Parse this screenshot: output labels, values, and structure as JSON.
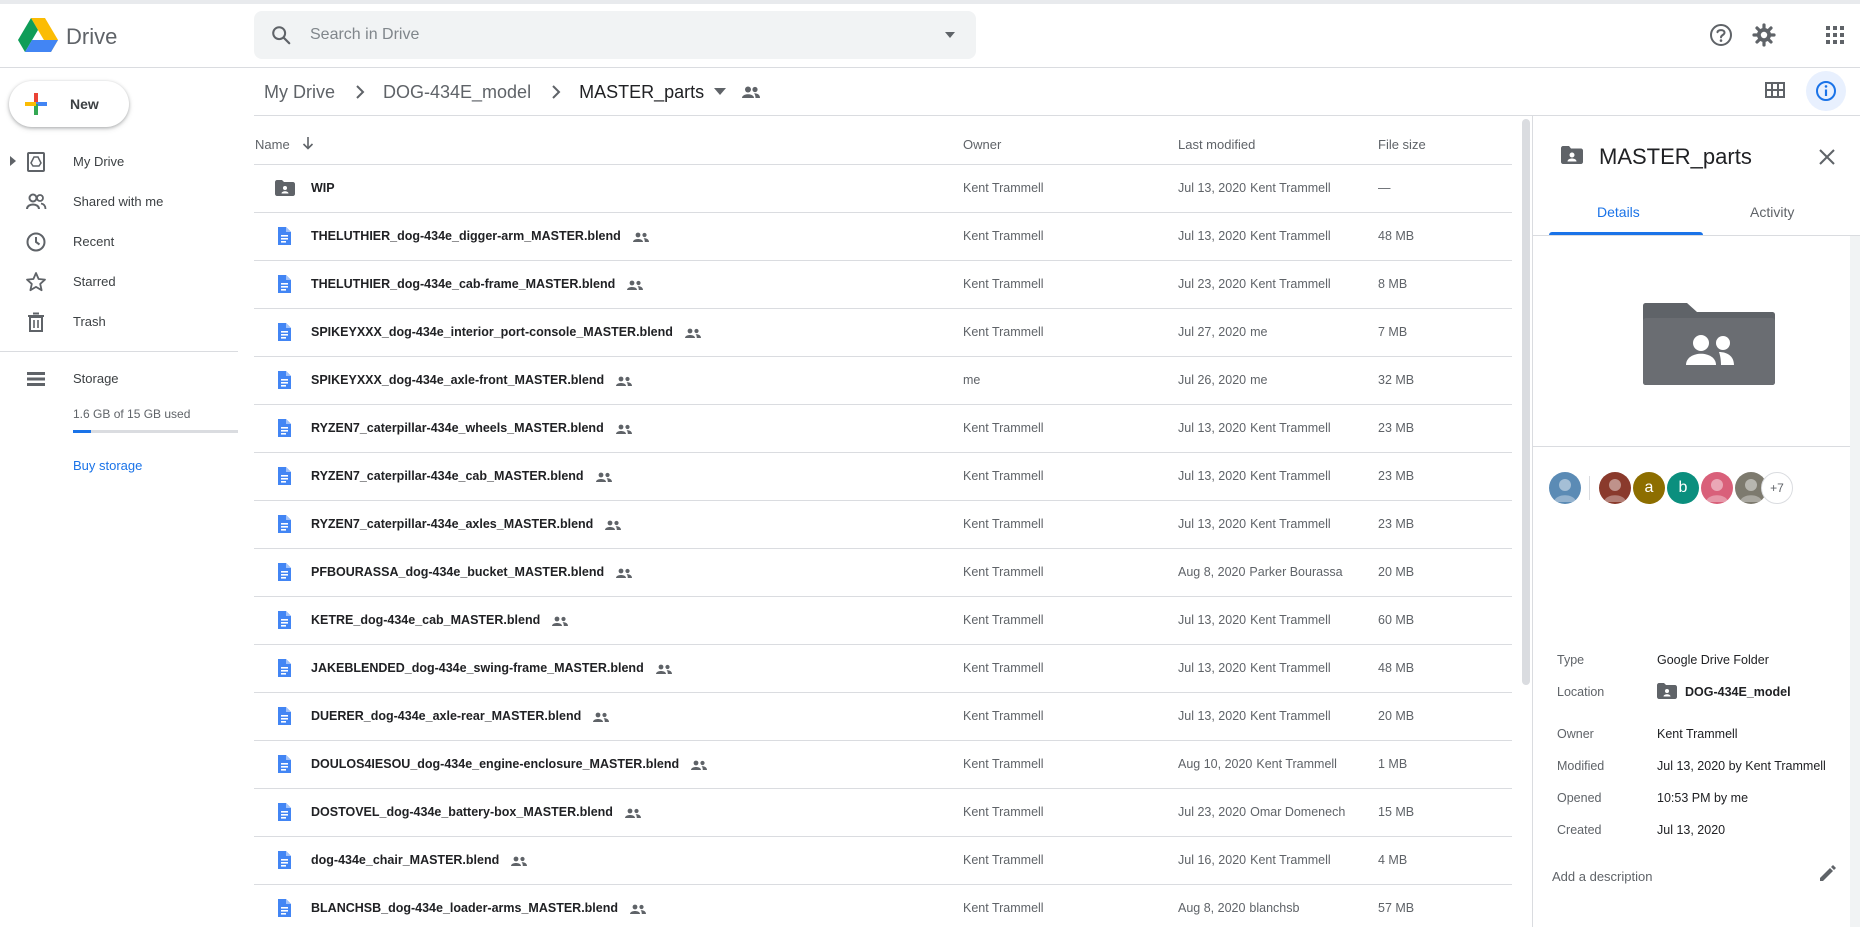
{
  "app": {
    "name": "Drive"
  },
  "search": {
    "placeholder": "Search in Drive"
  },
  "nav": {
    "new_label": "New",
    "items": [
      {
        "label": "My Drive",
        "icon": "my-drive-icon"
      },
      {
        "label": "Shared with me",
        "icon": "people-icon"
      },
      {
        "label": "Recent",
        "icon": "clock-icon"
      },
      {
        "label": "Starred",
        "icon": "star-icon"
      },
      {
        "label": "Trash",
        "icon": "trash-icon"
      }
    ],
    "storage_label": "Storage",
    "storage_used": "1.6 GB of 15 GB used",
    "storage_fraction": 0.107,
    "buy_storage": "Buy storage"
  },
  "breadcrumb": [
    "My Drive",
    "DOG-434E_model",
    "MASTER_parts"
  ],
  "table": {
    "headers": {
      "name": "Name",
      "owner": "Owner",
      "modified": "Last modified",
      "size": "File size"
    },
    "rows": [
      {
        "type": "shared-folder",
        "name": "WIP",
        "shared": false,
        "owner": "Kent Trammell",
        "date": "Jul 13, 2020",
        "by": "Kent Trammell",
        "size": "—"
      },
      {
        "type": "file",
        "name": "THELUTHIER_dog-434e_digger-arm_MASTER.blend",
        "shared": true,
        "owner": "Kent Trammell",
        "date": "Jul 13, 2020",
        "by": "Kent Trammell",
        "size": "48 MB"
      },
      {
        "type": "file",
        "name": "THELUTHIER_dog-434e_cab-frame_MASTER.blend",
        "shared": true,
        "owner": "Kent Trammell",
        "date": "Jul 23, 2020",
        "by": "Kent Trammell",
        "size": "8 MB"
      },
      {
        "type": "file",
        "name": "SPIKEYXXX_dog-434e_interior_port-console_MASTER.blend",
        "shared": true,
        "owner": "Kent Trammell",
        "date": "Jul 27, 2020",
        "by": "me",
        "size": "7 MB"
      },
      {
        "type": "file",
        "name": "SPIKEYXXX_dog-434e_axle-front_MASTER.blend",
        "shared": true,
        "owner": "me",
        "date": "Jul 26, 2020",
        "by": "me",
        "size": "32 MB"
      },
      {
        "type": "file",
        "name": "RYZEN7_caterpillar-434e_wheels_MASTER.blend",
        "shared": true,
        "owner": "Kent Trammell",
        "date": "Jul 13, 2020",
        "by": "Kent Trammell",
        "size": "23 MB"
      },
      {
        "type": "file",
        "name": "RYZEN7_caterpillar-434e_cab_MASTER.blend",
        "shared": true,
        "owner": "Kent Trammell",
        "date": "Jul 13, 2020",
        "by": "Kent Trammell",
        "size": "23 MB"
      },
      {
        "type": "file",
        "name": "RYZEN7_caterpillar-434e_axles_MASTER.blend",
        "shared": true,
        "owner": "Kent Trammell",
        "date": "Jul 13, 2020",
        "by": "Kent Trammell",
        "size": "23 MB"
      },
      {
        "type": "file",
        "name": "PFBOURASSA_dog-434e_bucket_MASTER.blend",
        "shared": true,
        "owner": "Kent Trammell",
        "date": "Aug 8, 2020",
        "by": "Parker Bourassa",
        "size": "20 MB"
      },
      {
        "type": "file",
        "name": "KETRE_dog-434e_cab_MASTER.blend",
        "shared": true,
        "owner": "Kent Trammell",
        "date": "Jul 13, 2020",
        "by": "Kent Trammell",
        "size": "60 MB"
      },
      {
        "type": "file",
        "name": "JAKEBLENDED_dog-434e_swing-frame_MASTER.blend",
        "shared": true,
        "owner": "Kent Trammell",
        "date": "Jul 13, 2020",
        "by": "Kent Trammell",
        "size": "48 MB"
      },
      {
        "type": "file",
        "name": "DUERER_dog-434e_axle-rear_MASTER.blend",
        "shared": true,
        "owner": "Kent Trammell",
        "date": "Jul 13, 2020",
        "by": "Kent Trammell",
        "size": "20 MB"
      },
      {
        "type": "file",
        "name": "DOULOS4IESOU_dog-434e_engine-enclosure_MASTER.blend",
        "shared": true,
        "owner": "Kent Trammell",
        "date": "Aug 10, 2020",
        "by": "Kent Trammell",
        "size": "1 MB"
      },
      {
        "type": "file",
        "name": "DOSTOVEL_dog-434e_battery-box_MASTER.blend",
        "shared": true,
        "owner": "Kent Trammell",
        "date": "Jul 23, 2020",
        "by": "Omar Domenech",
        "size": "15 MB"
      },
      {
        "type": "file",
        "name": "dog-434e_chair_MASTER.blend",
        "shared": true,
        "owner": "Kent Trammell",
        "date": "Jul 16, 2020",
        "by": "Kent Trammell",
        "size": "4 MB"
      },
      {
        "type": "file",
        "name": "BLANCHSB_dog-434e_loader-arms_MASTER.blend",
        "shared": true,
        "owner": "Kent Trammell",
        "date": "Aug 8, 2020",
        "by": "blanchsb",
        "size": "57 MB"
      }
    ]
  },
  "details": {
    "title": "MASTER_parts",
    "tabs": [
      "Details",
      "Activity"
    ],
    "avatars": [
      {
        "kind": "photo",
        "color": "#5b8bb5"
      },
      {
        "kind": "photo",
        "color": "#8a3a2c"
      },
      {
        "kind": "letter",
        "letter": "a",
        "color": "#8d6e00"
      },
      {
        "kind": "letter",
        "letter": "b",
        "color": "#0b8f7e"
      },
      {
        "kind": "photo",
        "color": "#d9607a"
      },
      {
        "kind": "photo",
        "color": "#7d7a6e"
      }
    ],
    "more_count": "+7",
    "props": {
      "type_label": "Type",
      "type_value": "Google Drive Folder",
      "location_label": "Location",
      "location_value": "DOG-434E_model",
      "owner_label": "Owner",
      "owner_value": "Kent Trammell",
      "modified_label": "Modified",
      "modified_value": "Jul 13, 2020 by Kent Trammell",
      "opened_label": "Opened",
      "opened_value": "10:53 PM by me",
      "created_label": "Created",
      "created_value": "Jul 13, 2020"
    },
    "description_placeholder": "Add a description"
  },
  "colors": {
    "accent": "#1a73e8",
    "file_icon": "#4285f4",
    "folder_icon": "#5f6368"
  }
}
